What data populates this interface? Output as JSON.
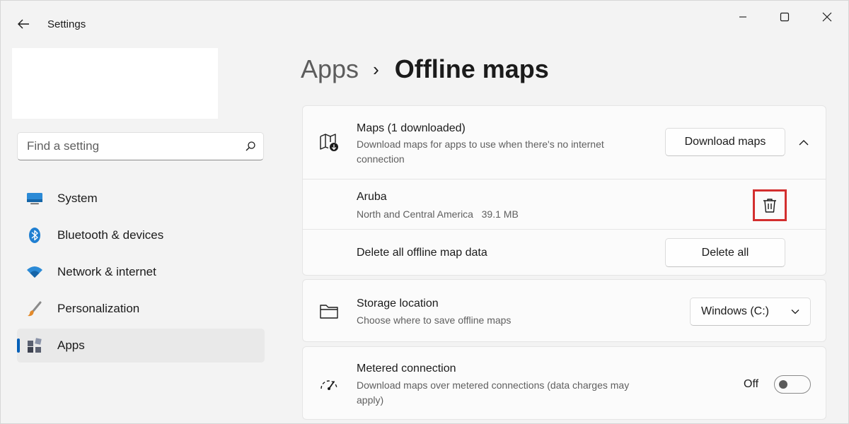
{
  "window": {
    "title": "Settings"
  },
  "sidebar": {
    "search": {
      "placeholder": "Find a setting",
      "value": ""
    },
    "items": [
      {
        "label": "System",
        "icon": "monitor-icon",
        "active": false
      },
      {
        "label": "Bluetooth & devices",
        "icon": "bluetooth-icon",
        "active": false
      },
      {
        "label": "Network & internet",
        "icon": "wifi-icon",
        "active": false
      },
      {
        "label": "Personalization",
        "icon": "brush-icon",
        "active": false
      },
      {
        "label": "Apps",
        "icon": "apps-icon",
        "active": true
      }
    ]
  },
  "breadcrumb": {
    "parent": "Apps",
    "separator": "›",
    "current": "Offline maps"
  },
  "maps_card": {
    "title": "Maps (1 downloaded)",
    "description": "Download maps for apps to use when there's no internet connection",
    "download_button": "Download maps",
    "map_entry": {
      "name": "Aruba",
      "region": "North and Central America",
      "size": "39.1 MB"
    },
    "delete_all_label": "Delete all offline map data",
    "delete_all_button": "Delete all"
  },
  "storage_card": {
    "title": "Storage location",
    "description": "Choose where to save offline maps",
    "selected": "Windows (C:)"
  },
  "metered_card": {
    "title": "Metered connection",
    "description": "Download maps over metered connections (data charges may apply)",
    "toggle_state": "Off"
  },
  "colors": {
    "accent": "#005fb8",
    "highlight": "#d32f2f"
  }
}
